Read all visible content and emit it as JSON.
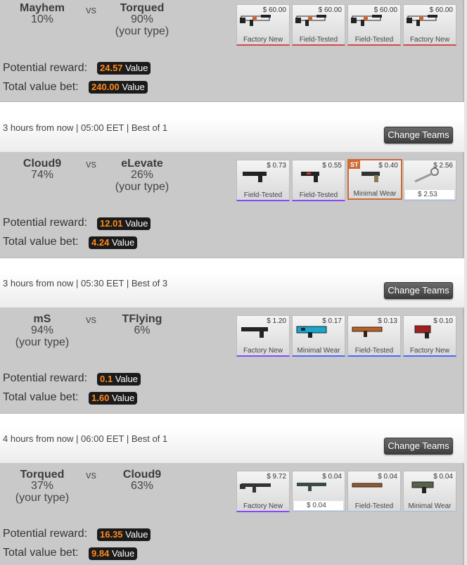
{
  "matches": [
    {
      "team1": {
        "name": "Mayhem",
        "pct": "10%",
        "note": ""
      },
      "team2": {
        "name": "Torqued",
        "pct": "90%",
        "note": "(your type)"
      },
      "vs": "vs",
      "reward_label": "Potential reward:",
      "reward_value": "24.57",
      "reward_unit": "Value",
      "bet_label": "Total value bet:",
      "bet_value": "240.00",
      "bet_unit": "Value",
      "items": [
        {
          "price": "$ 60.00",
          "cond": "Factory New",
          "rarity": "#d04b4b",
          "icon": "rifle-white-icon"
        },
        {
          "price": "$ 60.00",
          "cond": "Field-Tested",
          "rarity": "#d04b4b",
          "icon": "rifle-white-icon"
        },
        {
          "price": "$ 60.00",
          "cond": "Field-Tested",
          "rarity": "#d04b4b",
          "icon": "rifle-white-icon"
        },
        {
          "price": "$ 60.00",
          "cond": "Factory New",
          "rarity": "#d04b4b",
          "icon": "rifle-white-icon"
        }
      ]
    },
    {
      "header": "3 hours from now | 05:00 EET | Best of 1",
      "button": "Change Teams",
      "team1": {
        "name": "Cloud9",
        "pct": "74%",
        "note": ""
      },
      "team2": {
        "name": "eLevate",
        "pct": "26%",
        "note": "(your type)"
      },
      "vs": "vs",
      "reward_label": "Potential reward:",
      "reward_value": "12.01",
      "reward_unit": "Value",
      "bet_label": "Total value bet:",
      "bet_value": "4.24",
      "bet_unit": "Value",
      "items": [
        {
          "price": "$ 0.73",
          "cond": "Field-Tested",
          "rarity": "#8847ff",
          "icon": "pistol-icon"
        },
        {
          "price": "$ 0.55",
          "cond": "Field-Tested",
          "rarity": "#8847ff",
          "icon": "pistol-icon"
        },
        {
          "price": "$ 0.40",
          "cond": "Minimal Wear",
          "rarity": "#4b69ff",
          "icon": "pistol-icon",
          "st": "ST"
        },
        {
          "price": "$ 2.56",
          "cond": "$ 2.53",
          "rarity": "#b0c3d9",
          "icon": "key-icon",
          "sub": true
        }
      ]
    },
    {
      "header": "3 hours from now | 05:30 EET | Best of 3",
      "button": "Change Teams",
      "team1": {
        "name": "mS",
        "pct": "94%",
        "note": "(your type)"
      },
      "team2": {
        "name": "TFlying",
        "pct": "6%",
        "note": ""
      },
      "vs": "vs",
      "reward_label": "Potential reward:",
      "reward_value": "0.1",
      "reward_unit": "Value",
      "bet_label": "Total value bet:",
      "bet_value": "1.60",
      "bet_unit": "Value",
      "items": [
        {
          "price": "$ 1.20",
          "cond": "Factory New",
          "rarity": "#8847ff",
          "icon": "pistol-icon"
        },
        {
          "price": "$ 0.17",
          "cond": "Minimal Wear",
          "rarity": "#4b69ff",
          "icon": "smg-blue-icon"
        },
        {
          "price": "$ 0.13",
          "cond": "Field-Tested",
          "rarity": "#4b69ff",
          "icon": "rifle-orange-icon"
        },
        {
          "price": "$ 0.10",
          "cond": "Factory New",
          "rarity": "#4b69ff",
          "icon": "smg-red-icon"
        }
      ]
    },
    {
      "header": "4 hours from now | 06:00 EET | Best of 1",
      "button": "Change Teams",
      "team1": {
        "name": "Torqued",
        "pct": "37%",
        "note": "(your type)"
      },
      "team2": {
        "name": "Cloud9",
        "pct": "63%",
        "note": ""
      },
      "vs": "vs",
      "reward_label": "Potential reward:",
      "reward_value": "16.35",
      "reward_unit": "Value",
      "bet_label": "Total value bet:",
      "bet_value": "9.84",
      "bet_unit": "Value",
      "items": [
        {
          "price": "$ 9.72",
          "cond": "Factory New",
          "rarity": "#8847ff",
          "icon": "rifle-dark-icon"
        },
        {
          "price": "$ 0.04",
          "cond": "$ 0.04",
          "rarity": "#b0c3d9",
          "icon": "rifle-dark-icon",
          "sub": true
        },
        {
          "price": "$ 0.04",
          "cond": "Field-Tested",
          "rarity": "#b0c3d9",
          "icon": "shotgun-icon"
        },
        {
          "price": "$ 0.04",
          "cond": "Minimal Wear",
          "rarity": "#b0c3d9",
          "icon": "smg-camo-icon"
        }
      ]
    }
  ]
}
